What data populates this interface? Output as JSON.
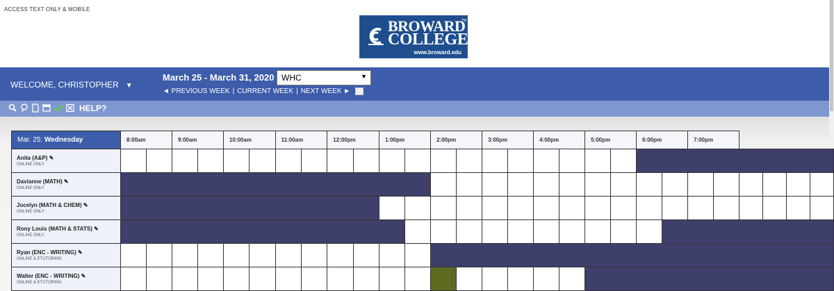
{
  "access_link": "ACCESS TEXT ONLY & MOBILE",
  "logo": {
    "line1": "BROWARD",
    "line2": "COLLEGE",
    "url": "www.broward.edu",
    "tm": "TM"
  },
  "header": {
    "welcome": "WELCOME, CHRISTOPHER",
    "caret": "▼",
    "date_range": "March 25 - March 31, 2020",
    "location_select": "WHC",
    "select_caret": "▼",
    "prev_week": "◄ PREVIOUS WEEK",
    "current_week": "CURRENT WEEK",
    "next_week": "NEXT WEEK ►",
    "separator": "|"
  },
  "toolbar": {
    "help": "HELP?"
  },
  "schedule": {
    "day_prefix": "Mar. 25:",
    "day_name": "Wednesday",
    "hours": [
      "8:00am",
      "9:00am",
      "10:00am",
      "11:00am",
      "12:00pm",
      "1:00pm",
      "2:00pm",
      "3:00pm",
      "4:00pm",
      "5:00pm",
      "6:00pm",
      "7:00pm"
    ],
    "tutors": [
      {
        "name": "Anita (A&P)",
        "mode": "ONLINE ONLY",
        "slots": "0000000000000000000011111111"
      },
      {
        "name": "Davianne (MATH)",
        "mode": "ONLINE ONLY",
        "slots": "1111111111110000000000000000"
      },
      {
        "name": "Jocelyn (MATH & CHEM)",
        "mode": "ONLINE ONLY",
        "slots": "1111111111000000000000000000"
      },
      {
        "name": "Rony Louis (MATH & STATS)",
        "mode": "ONLINE ONLY",
        "slots": "1111111111100000000001111111"
      },
      {
        "name": "Ryan (ENC - WRITING)",
        "mode": "ONLINE & ETUTORING",
        "slots": "0000000000001111111111111111"
      },
      {
        "name": "Walter (ENC - WRITING)",
        "mode": "ONLINE & ETUTORING",
        "slots": "0000000000002000001111111111"
      }
    ]
  },
  "colors": {
    "header_blue": "#3d5daa",
    "toolbar_blue": "#7e98cf",
    "busy": "#3f3f6b",
    "booked": "#5c6b1f"
  }
}
